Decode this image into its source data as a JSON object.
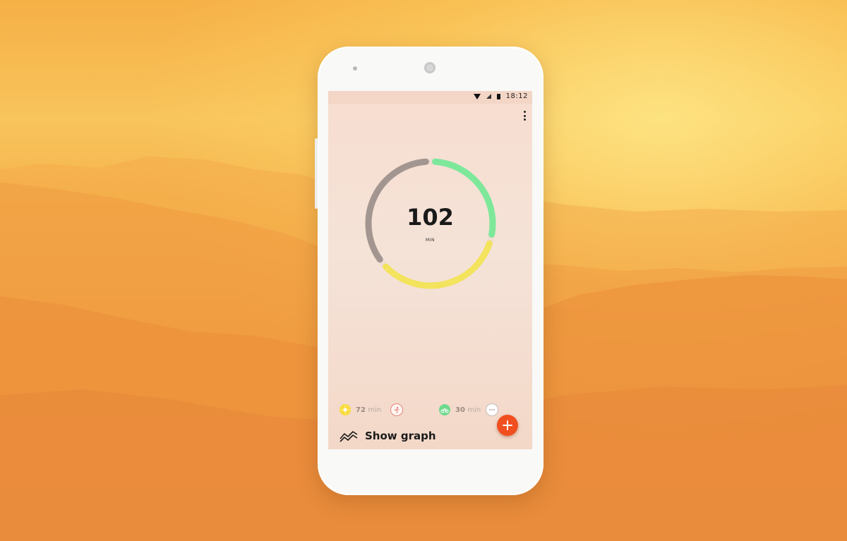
{
  "status_bar": {
    "time": "18:12",
    "icons": [
      "wifi-icon",
      "signal-icon",
      "battery-icon"
    ]
  },
  "menu": {
    "icon": "overflow-menu-icon"
  },
  "summary": {
    "total_value": "102",
    "unit": "MIN",
    "ring_segments": [
      {
        "name": "green",
        "color": "#7ee89a",
        "fraction": 0.29
      },
      {
        "name": "yellow",
        "color": "#f3e35d",
        "fraction": 0.35
      },
      {
        "name": "gray",
        "color": "#a39690",
        "fraction": 0.36
      }
    ]
  },
  "activities": [
    {
      "icon": "sun-icon",
      "color": "#f9dc3c",
      "value": "72",
      "unit": "min"
    },
    {
      "icon": "run-icon",
      "color": "#e8857c"
    },
    {
      "icon": "bike-icon",
      "color": "#6fd98d",
      "value": "30",
      "unit": "min"
    },
    {
      "icon": "more-icon",
      "color": "#c9bdb7"
    }
  ],
  "graph": {
    "label": "Show graph",
    "icon": "trend-graph-icon"
  },
  "fab": {
    "icon": "plus-icon",
    "color": "#f04f1f"
  }
}
